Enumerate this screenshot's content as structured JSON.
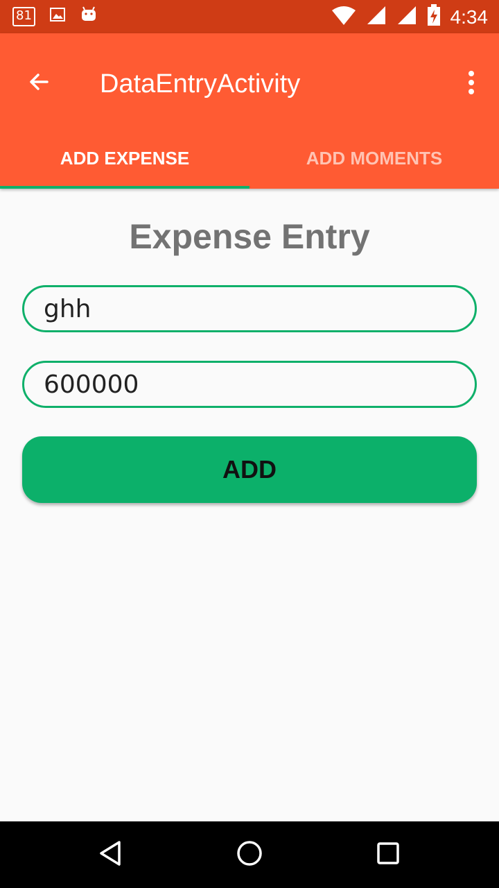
{
  "status_bar": {
    "notification_count": "81",
    "time": "4:34",
    "icons": [
      "notification-badge-icon",
      "image-icon",
      "android-icon",
      "wifi-icon",
      "signal-icon",
      "signal-icon",
      "battery-charging-icon"
    ]
  },
  "app_bar": {
    "title": "DataEntryActivity",
    "back_icon": "arrow-back-icon",
    "menu_icon": "more-vert-icon"
  },
  "tabs": [
    {
      "label": "ADD EXPENSE",
      "selected": true
    },
    {
      "label": "ADD MOMENTS",
      "selected": false
    }
  ],
  "form": {
    "heading": "Expense Entry",
    "name_value": "ghh",
    "amount_value": "600000",
    "add_label": "ADD"
  },
  "nav_bar": {
    "buttons": [
      "back-triangle-icon",
      "home-circle-icon",
      "recents-square-icon"
    ]
  },
  "colors": {
    "status_bar": "#cf3c15",
    "app_bar": "#ff5b33",
    "accent": "#0fb06a",
    "background": "#fafafa"
  }
}
